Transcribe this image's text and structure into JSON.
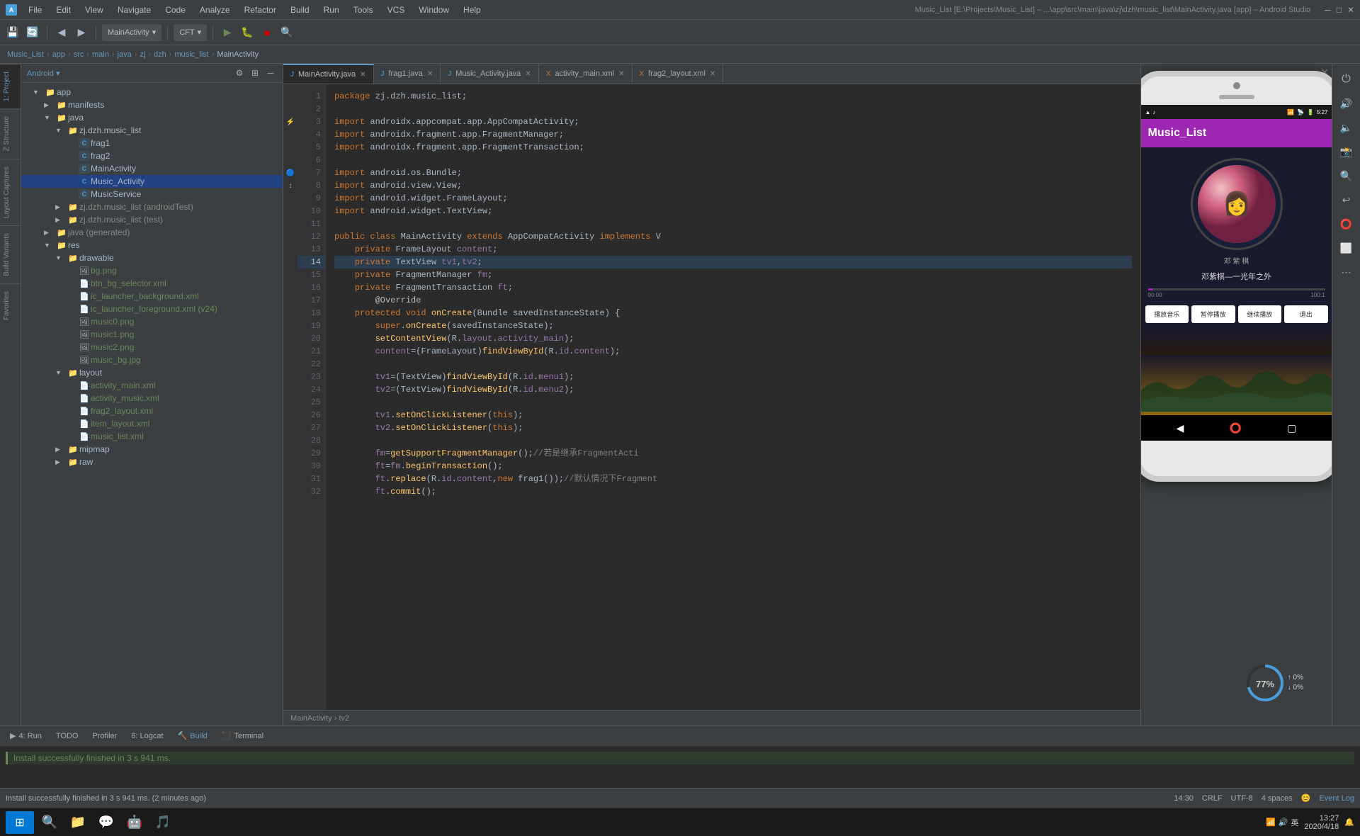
{
  "app": {
    "title": "Music_List [E:\\Projects\\Music_List] – ...\\app\\src\\main\\java\\zj\\dzh\\music_list\\MainActivity.java [app] – Android Studio",
    "name": "Android Studio"
  },
  "menu": {
    "items": [
      "File",
      "Edit",
      "View",
      "Navigate",
      "Code",
      "Analyze",
      "Refactor",
      "Build",
      "Run",
      "Tools",
      "VCS",
      "Window",
      "Help"
    ]
  },
  "toolbar": {
    "dropdown1": "MainActivity",
    "dropdown2": "CFT",
    "run_label": "Run",
    "debug_label": "Debug"
  },
  "breadcrumb": {
    "items": [
      "Music_List",
      "app",
      "src",
      "main",
      "java",
      "zj",
      "dzh",
      "music_list",
      "MainActivity"
    ]
  },
  "sidebar": {
    "title": "Android",
    "tree": [
      {
        "label": "app",
        "type": "folder",
        "level": 0,
        "expanded": true
      },
      {
        "label": "manifests",
        "type": "folder",
        "level": 1,
        "expanded": false
      },
      {
        "label": "java",
        "type": "folder",
        "level": 1,
        "expanded": true
      },
      {
        "label": "zj.dzh.music_list",
        "type": "folder",
        "level": 2,
        "expanded": true
      },
      {
        "label": "frag1",
        "type": "java",
        "level": 3
      },
      {
        "label": "frag2",
        "type": "java",
        "level": 3
      },
      {
        "label": "MainActivity",
        "type": "java",
        "level": 3
      },
      {
        "label": "Music_Activity",
        "type": "java",
        "level": 3,
        "selected": true
      },
      {
        "label": "MusicService",
        "type": "java",
        "level": 3
      },
      {
        "label": "zj.dzh.music_list (androidTest)",
        "type": "folder",
        "level": 2
      },
      {
        "label": "zj.dzh.music_list (test)",
        "type": "folder",
        "level": 2
      },
      {
        "label": "java (generated)",
        "type": "folder",
        "level": 1
      },
      {
        "label": "res",
        "type": "folder",
        "level": 1,
        "expanded": true
      },
      {
        "label": "drawable",
        "type": "folder",
        "level": 2,
        "expanded": true
      },
      {
        "label": "bg.png",
        "type": "png",
        "level": 3
      },
      {
        "label": "btn_bg_selector.xml",
        "type": "xml",
        "level": 3
      },
      {
        "label": "ic_launcher_background.xml",
        "type": "xml",
        "level": 3
      },
      {
        "label": "ic_launcher_foreground.xml (v24)",
        "type": "xml",
        "level": 3
      },
      {
        "label": "music0.png",
        "type": "png",
        "level": 3
      },
      {
        "label": "music1.png",
        "type": "png",
        "level": 3
      },
      {
        "label": "music2.png",
        "type": "png",
        "level": 3
      },
      {
        "label": "music_bg.jpg",
        "type": "jpg",
        "level": 3
      },
      {
        "label": "layout",
        "type": "folder",
        "level": 2,
        "expanded": true
      },
      {
        "label": "activity_main.xml",
        "type": "xml",
        "level": 3
      },
      {
        "label": "activity_music.xml",
        "type": "xml",
        "level": 3
      },
      {
        "label": "frag2_layout.xml",
        "type": "xml",
        "level": 3
      },
      {
        "label": "item_layout.xml",
        "type": "xml",
        "level": 3
      },
      {
        "label": "music_list.xml",
        "type": "xml",
        "level": 3
      },
      {
        "label": "mipmap",
        "type": "folder",
        "level": 2
      },
      {
        "label": "raw",
        "type": "folder",
        "level": 2
      }
    ]
  },
  "tabs": [
    {
      "label": "MainActivity.java",
      "type": "java",
      "active": true
    },
    {
      "label": "frag1.java",
      "type": "java"
    },
    {
      "label": "Music_Activity.java",
      "type": "java"
    },
    {
      "label": "activity_main.xml",
      "type": "xml"
    },
    {
      "label": "frag2_layout.xml",
      "type": "xml"
    }
  ],
  "code": {
    "lines": [
      {
        "num": 1,
        "content": "package zj.dzh.music_list;",
        "highlighted": false
      },
      {
        "num": 2,
        "content": "",
        "highlighted": false
      },
      {
        "num": 3,
        "content": "import androidx.appcompat.app.AppCompatActivity;",
        "highlighted": false
      },
      {
        "num": 4,
        "content": "import androidx.fragment.app.FragmentManager;",
        "highlighted": false
      },
      {
        "num": 5,
        "content": "import androidx.fragment.app.FragmentTransaction;",
        "highlighted": false
      },
      {
        "num": 6,
        "content": "",
        "highlighted": false
      },
      {
        "num": 7,
        "content": "import android.os.Bundle;",
        "highlighted": false
      },
      {
        "num": 8,
        "content": "import android.view.View;",
        "highlighted": false
      },
      {
        "num": 9,
        "content": "import android.widget.FrameLayout;",
        "highlighted": false
      },
      {
        "num": 10,
        "content": "import android.widget.TextView;",
        "highlighted": false
      },
      {
        "num": 11,
        "content": "",
        "highlighted": false
      },
      {
        "num": 12,
        "content": "public class MainActivity extends AppCompatActivity implements V",
        "highlighted": false
      },
      {
        "num": 13,
        "content": "    private FrameLayout content;",
        "highlighted": false
      },
      {
        "num": 14,
        "content": "    private TextView tv1,tv2;",
        "highlighted": true
      },
      {
        "num": 15,
        "content": "    private FragmentManager fm;",
        "highlighted": false
      },
      {
        "num": 16,
        "content": "    private FragmentTransaction ft;",
        "highlighted": false
      },
      {
        "num": 17,
        "content": "    @Override",
        "highlighted": false
      },
      {
        "num": 18,
        "content": "    protected void onCreate(Bundle savedInstanceState) {",
        "highlighted": false
      },
      {
        "num": 19,
        "content": "        super.onCreate(savedInstanceState);",
        "highlighted": false
      },
      {
        "num": 20,
        "content": "        setContentView(R.layout.activity_main);",
        "highlighted": false
      },
      {
        "num": 21,
        "content": "        content=(FrameLayout)findViewById(R.id.content);",
        "highlighted": false
      },
      {
        "num": 22,
        "content": "",
        "highlighted": false
      },
      {
        "num": 23,
        "content": "        tv1=(TextView)findViewById(R.id.menu1);",
        "highlighted": false
      },
      {
        "num": 24,
        "content": "        tv2=(TextView)findViewById(R.id.menu2);",
        "highlighted": false
      },
      {
        "num": 25,
        "content": "",
        "highlighted": false
      },
      {
        "num": 26,
        "content": "        tv1.setOnClickListener(this);",
        "highlighted": false
      },
      {
        "num": 27,
        "content": "        tv2.setOnClickListener(this);",
        "highlighted": false
      },
      {
        "num": 28,
        "content": "",
        "highlighted": false
      },
      {
        "num": 29,
        "content": "        fm=getSupportFragmentManager();//若是继承FragmentActi",
        "highlighted": false
      },
      {
        "num": 30,
        "content": "        ft=fm.beginTransaction();",
        "highlighted": false
      },
      {
        "num": 31,
        "content": "        ft.replace(R.id.content,new frag1());//默认情况下Fragment",
        "highlighted": false
      },
      {
        "num": 32,
        "content": "        ft.commit();",
        "highlighted": false
      }
    ],
    "breadcrumb": "MainActivity › tv2"
  },
  "phone": {
    "status_time": "5:27",
    "app_title": "Music_List",
    "song_title": "邓紫棋—一光年之外",
    "artist": "邓 紫 棋",
    "progress_current": "00:00",
    "progress_total": "100:1",
    "buttons": [
      "播放音乐",
      "暂停播放",
      "继续播放",
      "退出"
    ]
  },
  "bottom_tabs": [
    {
      "label": "4: Run",
      "icon": "▶"
    },
    {
      "label": "TODO",
      "icon": ""
    },
    {
      "label": "Profiler",
      "icon": ""
    },
    {
      "label": "6: Logcat",
      "icon": ""
    },
    {
      "label": "Build",
      "icon": ""
    },
    {
      "label": "Terminal",
      "icon": ""
    }
  ],
  "status": {
    "build_message": "Install successfully finished in 3 s 941 ms.",
    "build_full": "Install successfully finished in 3 s 941 ms. (2 minutes ago)",
    "position": "14:30",
    "line_sep": "CRLF",
    "encoding": "UTF-8",
    "indent": "4 spaces",
    "time": "13:27",
    "date": "2020/4/18"
  },
  "taskbar": {
    "apps": [
      "⊞",
      "🔍",
      "📁",
      "💬",
      "🤖",
      "🎵"
    ],
    "time": "13:27",
    "date": "2020/4/18"
  },
  "right_tools": {
    "buttons": [
      "🔋",
      "🔊",
      "🔈",
      "📸",
      "🔍",
      "↩",
      "⭕",
      "⬜",
      "⋯"
    ]
  }
}
